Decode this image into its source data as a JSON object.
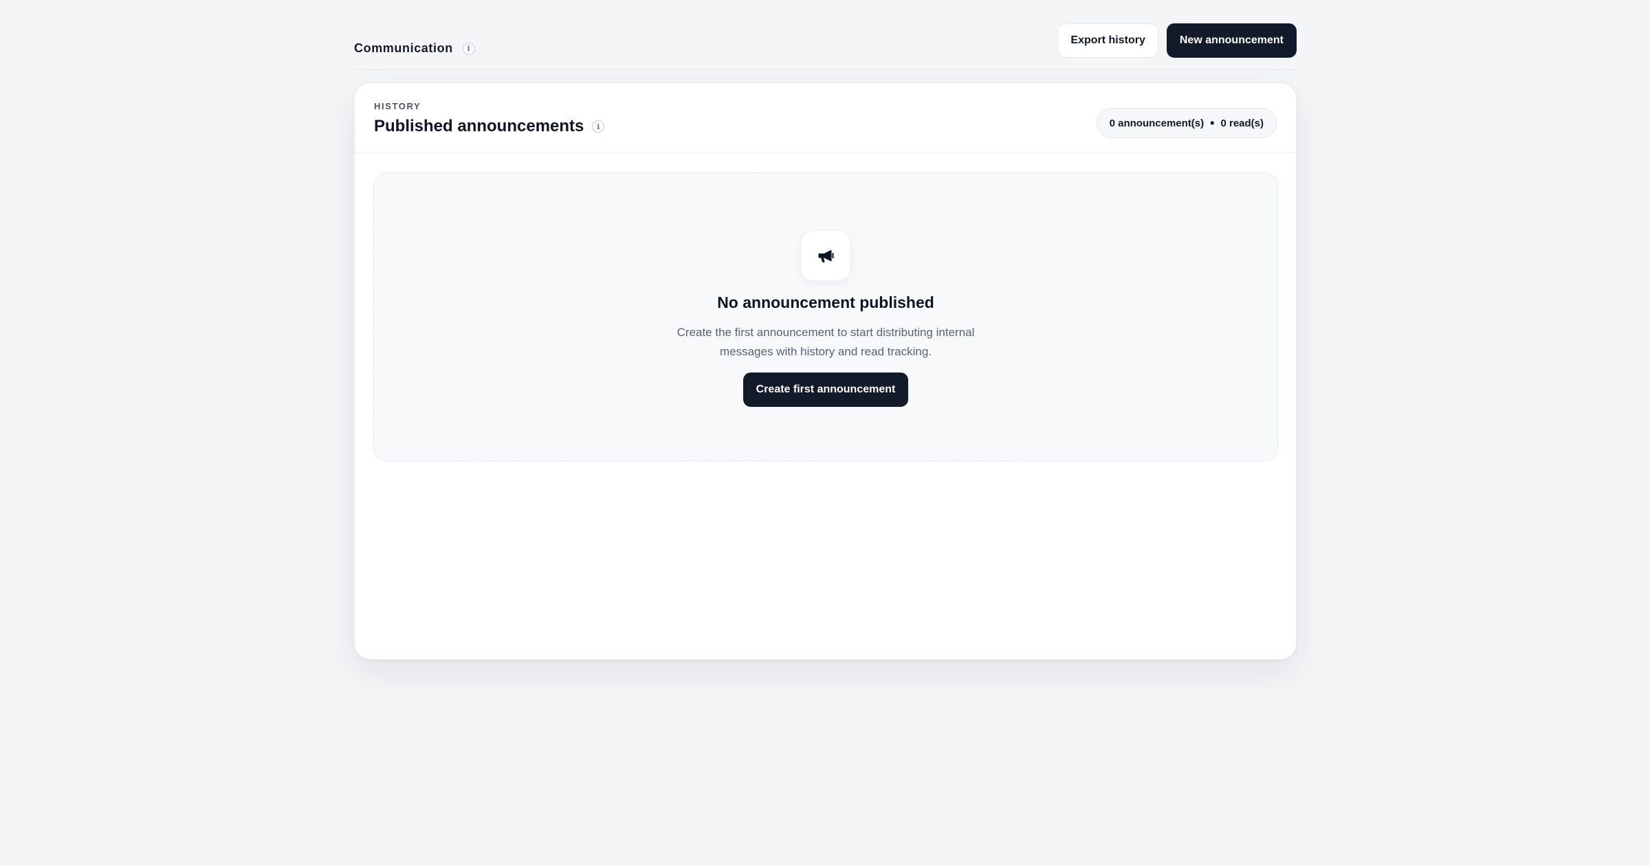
{
  "header": {
    "section_label": "Communication",
    "info_glyph": "i",
    "export_label": "Export history",
    "new_label": "New announcement"
  },
  "card": {
    "eyebrow": "HISTORY",
    "title": "Published announcements",
    "info_glyph": "i",
    "counter": {
      "announcements": "0 announcement(s)",
      "separator": "•",
      "reads": "0 read(s)"
    }
  },
  "empty_state": {
    "icon": "megaphone-icon",
    "title": "No announcement published",
    "description": "Create the first announcement to start distributing internal messages with history and read tracking.",
    "cta_label": "Create first announcement"
  },
  "colors": {
    "background": "#f4f5f7",
    "primary_dark": "#131a2a",
    "card": "#ffffff",
    "muted_text": "#5b6371"
  }
}
